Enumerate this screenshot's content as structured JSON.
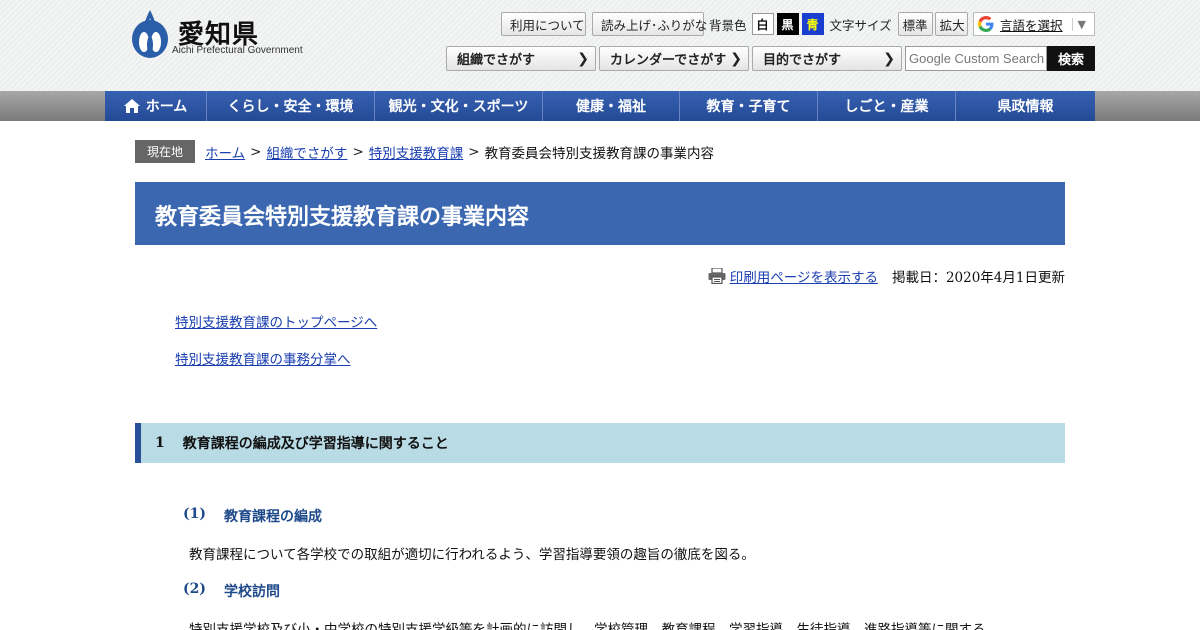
{
  "header": {
    "logo_text": "愛知県",
    "logo_sub": "Aichi Prefectural Government",
    "utility": {
      "usage_label": "利用について",
      "read_aloud_label": "読み上げ･ふりがな",
      "bg_color_label": "背景色",
      "bg_white": "白",
      "bg_black": "黒",
      "bg_blue": "青",
      "font_size_label": "文字サイズ",
      "font_standard": "標準",
      "font_enlarge": "拡大",
      "translate_label": "言語を選択",
      "translate_arrow": "▼"
    },
    "nav_buttons": [
      {
        "label": "組織でさがす",
        "icon": "chevron-right-icon"
      },
      {
        "label": "カレンダーでさがす",
        "icon": "chevron-right-icon"
      },
      {
        "label": "目的でさがす",
        "icon": "chevron-right-icon"
      }
    ],
    "search": {
      "placeholder": "Google Custom Search",
      "button_label": "検索"
    }
  },
  "global_nav": [
    {
      "label": "ホーム",
      "icon": "home-icon"
    },
    {
      "label": "くらし・安全・環境"
    },
    {
      "label": "観光・文化・スポーツ"
    },
    {
      "label": "健康・福祉"
    },
    {
      "label": "教育・子育て"
    },
    {
      "label": "しごと・産業"
    },
    {
      "label": "県政情報"
    }
  ],
  "breadcrumb": {
    "current_label": "現在地",
    "items": [
      "ホーム",
      "組織でさがす",
      "特別支援教育課"
    ],
    "current_page": "教育委員会特別支援教育課の事業内容"
  },
  "page": {
    "title": "教育委員会特別支援教育課の事業内容",
    "print_link": "印刷用ページを表示する",
    "date": "掲載日：2020年4月1日更新",
    "links": [
      "特別支援教育課のトップページへ",
      "特別支援教育課の事務分掌へ"
    ],
    "section": {
      "number": "1",
      "heading": "教育課程の編成及び学習指導に関すること",
      "subsections": [
        {
          "number": "(1)",
          "heading": "教育課程の編成",
          "text": "教育課程について各学校での取組が適切に行われるよう、学習指導要領の趣旨の徹底を図る。"
        },
        {
          "number": "(2)",
          "heading": "学校訪問",
          "text": "特別支援学校及び小・中学校の特別支援学級等を計画的に訪問し、学校管理、教育課程、学習指導、生徒指導、進路指導等に関する"
        }
      ]
    }
  },
  "colors": {
    "nav_blue": "#2a4f9b",
    "title_blue": "#3a67b0",
    "section_bg": "#b8dbe6",
    "link": "#1a3fb0"
  }
}
